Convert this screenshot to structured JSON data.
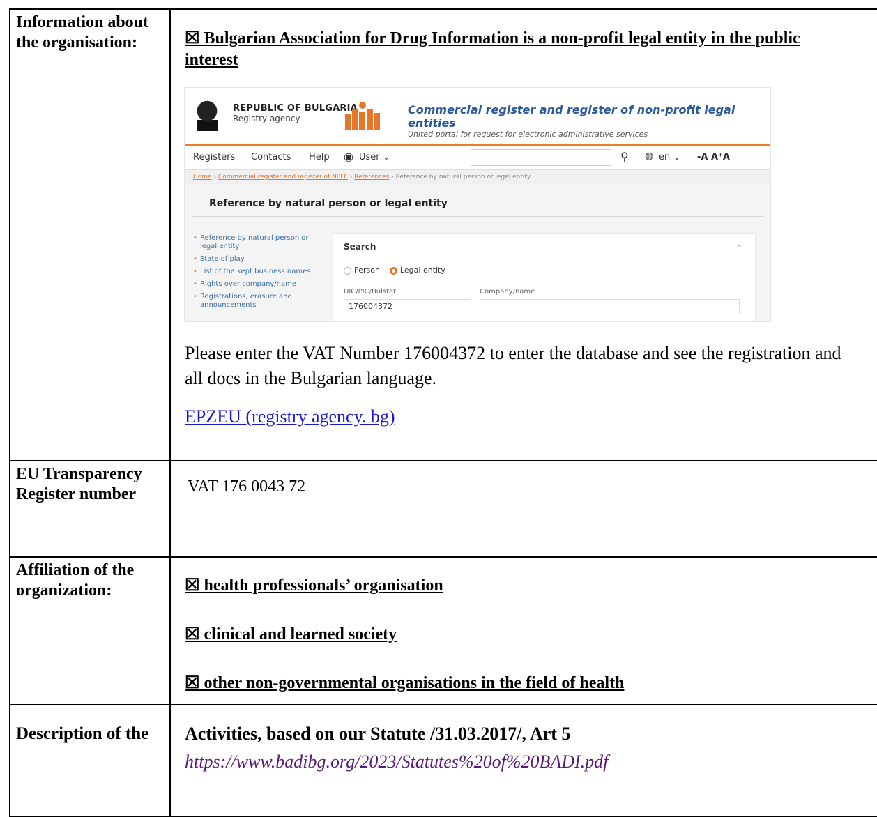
{
  "rows": {
    "info": {
      "label": "Information about the organisation:",
      "checkbox_line": "☒ Bulgarian Association for Drug Information is a non-profit legal entity in the public interest",
      "screenshot": {
        "agency_title": "REPUBLIC OF BULGARIA",
        "agency_sub": "Registry agency",
        "portal_title": "Commercial register and register of non-profit legal entities",
        "portal_sub": "United portal for request for electronic administrative services",
        "nav": {
          "registers": "Registers",
          "contacts": "Contacts",
          "help": "Help",
          "user": "User ⌄",
          "lang": "en ⌄",
          "font_sizes": "-A A⁺A"
        },
        "breadcrumb": {
          "home": "Home",
          "registers": "Commercial register and register of NPLE",
          "references": "References",
          "current": "Reference by natural person or legal entity"
        },
        "page_heading": "Reference by natural person or legal entity",
        "side_menu": [
          "Reference by natural person or legal entity",
          "State of play",
          "List of the kept business names",
          "Rights over company/name",
          "Registrations, erasure and announcements"
        ],
        "search": {
          "title": "Search",
          "radio_person": "Person",
          "radio_legal": "Legal entity",
          "uic_label": "UIC/PIC/Bulstat",
          "uic_value": "176004372",
          "company_label": "Company/name",
          "company_value": ""
        }
      },
      "instruction": "Please enter the VAT Number 176004372 to enter the database and see the registration and all docs in the Bulgarian language.",
      "link": "EPZEU (registry agency. bg)"
    },
    "eu": {
      "label": "EU Transparency Register number",
      "value": "VAT 176 0043 72"
    },
    "affiliation": {
      "label": "Affiliation of the organization:",
      "items": [
        "☒ health professionals’ organisation",
        "☒ clinical and learned society",
        "☒ other non-governmental organisations in the field of health"
      ]
    },
    "description": {
      "label": "Description of the",
      "activities": "Activities,  based on our Statute /31.03.2017/, Art 5",
      "statute_link": "https://www.badibg.org/2023/Statutes%20of%20BADI.pdf"
    }
  }
}
